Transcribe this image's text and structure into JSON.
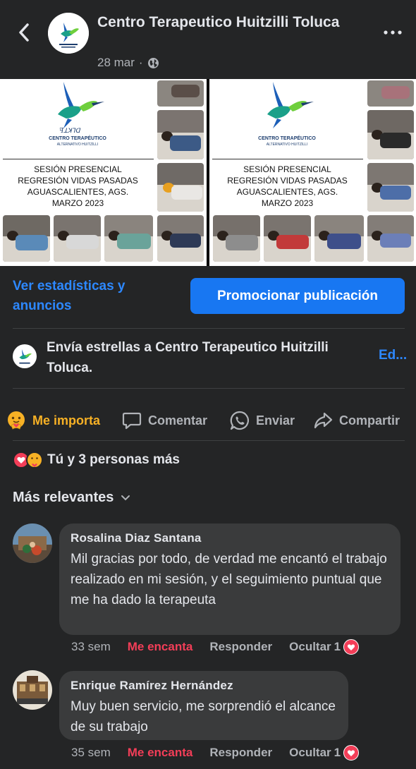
{
  "header": {
    "back_icon": "chevron-left-icon",
    "page_name": "Centro Terapeutico Huitzilli Toluca",
    "date": "28 mar",
    "separator": "·",
    "privacy_icon": "globe-icon",
    "more_icon": "more-horizontal-icon"
  },
  "post_photos": [
    {
      "brand_line1": "CENTRO TERAPÉUTICO",
      "brand_line2": "ALTERNATIVO HUITZILLI",
      "session_lines": [
        "SESIÓN PRESENCIAL",
        "REGRESIÓN VIDAS PASADAS",
        "AGUASCALIENTES, AGS.",
        "MARZO 2023"
      ]
    },
    {
      "brand_line1": "CENTRO TERAPÉUTICO",
      "brand_line2": "ALTERNATIVO HUITZILLI",
      "session_lines": [
        "SESIÓN PRESENCIAL",
        "REGRESIÓN VIDAS PASADAS",
        "AGUASCALIENTES, AGS.",
        "MARZO 2023"
      ]
    }
  ],
  "insights": {
    "stats_link": "Ver estadísticas y anuncios",
    "promote_button": "Promocionar publicación"
  },
  "stars": {
    "text": "Envía estrellas a Centro Terapeutico Huitzilli Toluca.",
    "edit_link": "Ed..."
  },
  "actions": [
    {
      "label": "Me importa",
      "icon": "care-reaction-icon",
      "active": true
    },
    {
      "label": "Comentar",
      "icon": "comment-icon",
      "active": false
    },
    {
      "label": "Enviar",
      "icon": "whatsapp-icon",
      "active": false
    },
    {
      "label": "Compartir",
      "icon": "share-icon",
      "active": false
    }
  ],
  "reactions_summary": {
    "icons": [
      "love-reaction-icon",
      "care-reaction-icon"
    ],
    "text": "Tú y 3 personas más"
  },
  "sort": {
    "label": "Más relevantes",
    "icon": "chevron-down-icon"
  },
  "comments": [
    {
      "author": "Rosalina Diaz Santana",
      "text": "Mil gracias por todo, de verdad me encantó el trabajo realizado en mi sesión, y el seguimiento puntual que me ha dado la terapeuta",
      "time": "33 sem",
      "reaction_label": "Me encanta",
      "reply_label": "Responder",
      "hide_label": "Ocultar",
      "reaction_count": "1",
      "reaction_icon": "love-reaction-icon"
    },
    {
      "author": "Enrique Ramírez Hernández",
      "text": "Muy buen servicio, me sorprendió el alcance de su trabajo",
      "time": "35 sem",
      "reaction_label": "Me encanta",
      "reply_label": "Responder",
      "hide_label": "Ocultar",
      "reaction_count": "1",
      "reaction_icon": "love-reaction-icon"
    }
  ],
  "colors": {
    "background": "#242526",
    "accent_blue": "#2d88ff",
    "primary_button": "#1877f2",
    "care_reaction": "#f7b125",
    "love_reaction": "#f33e58",
    "comment_bubble": "#3a3b3c"
  }
}
